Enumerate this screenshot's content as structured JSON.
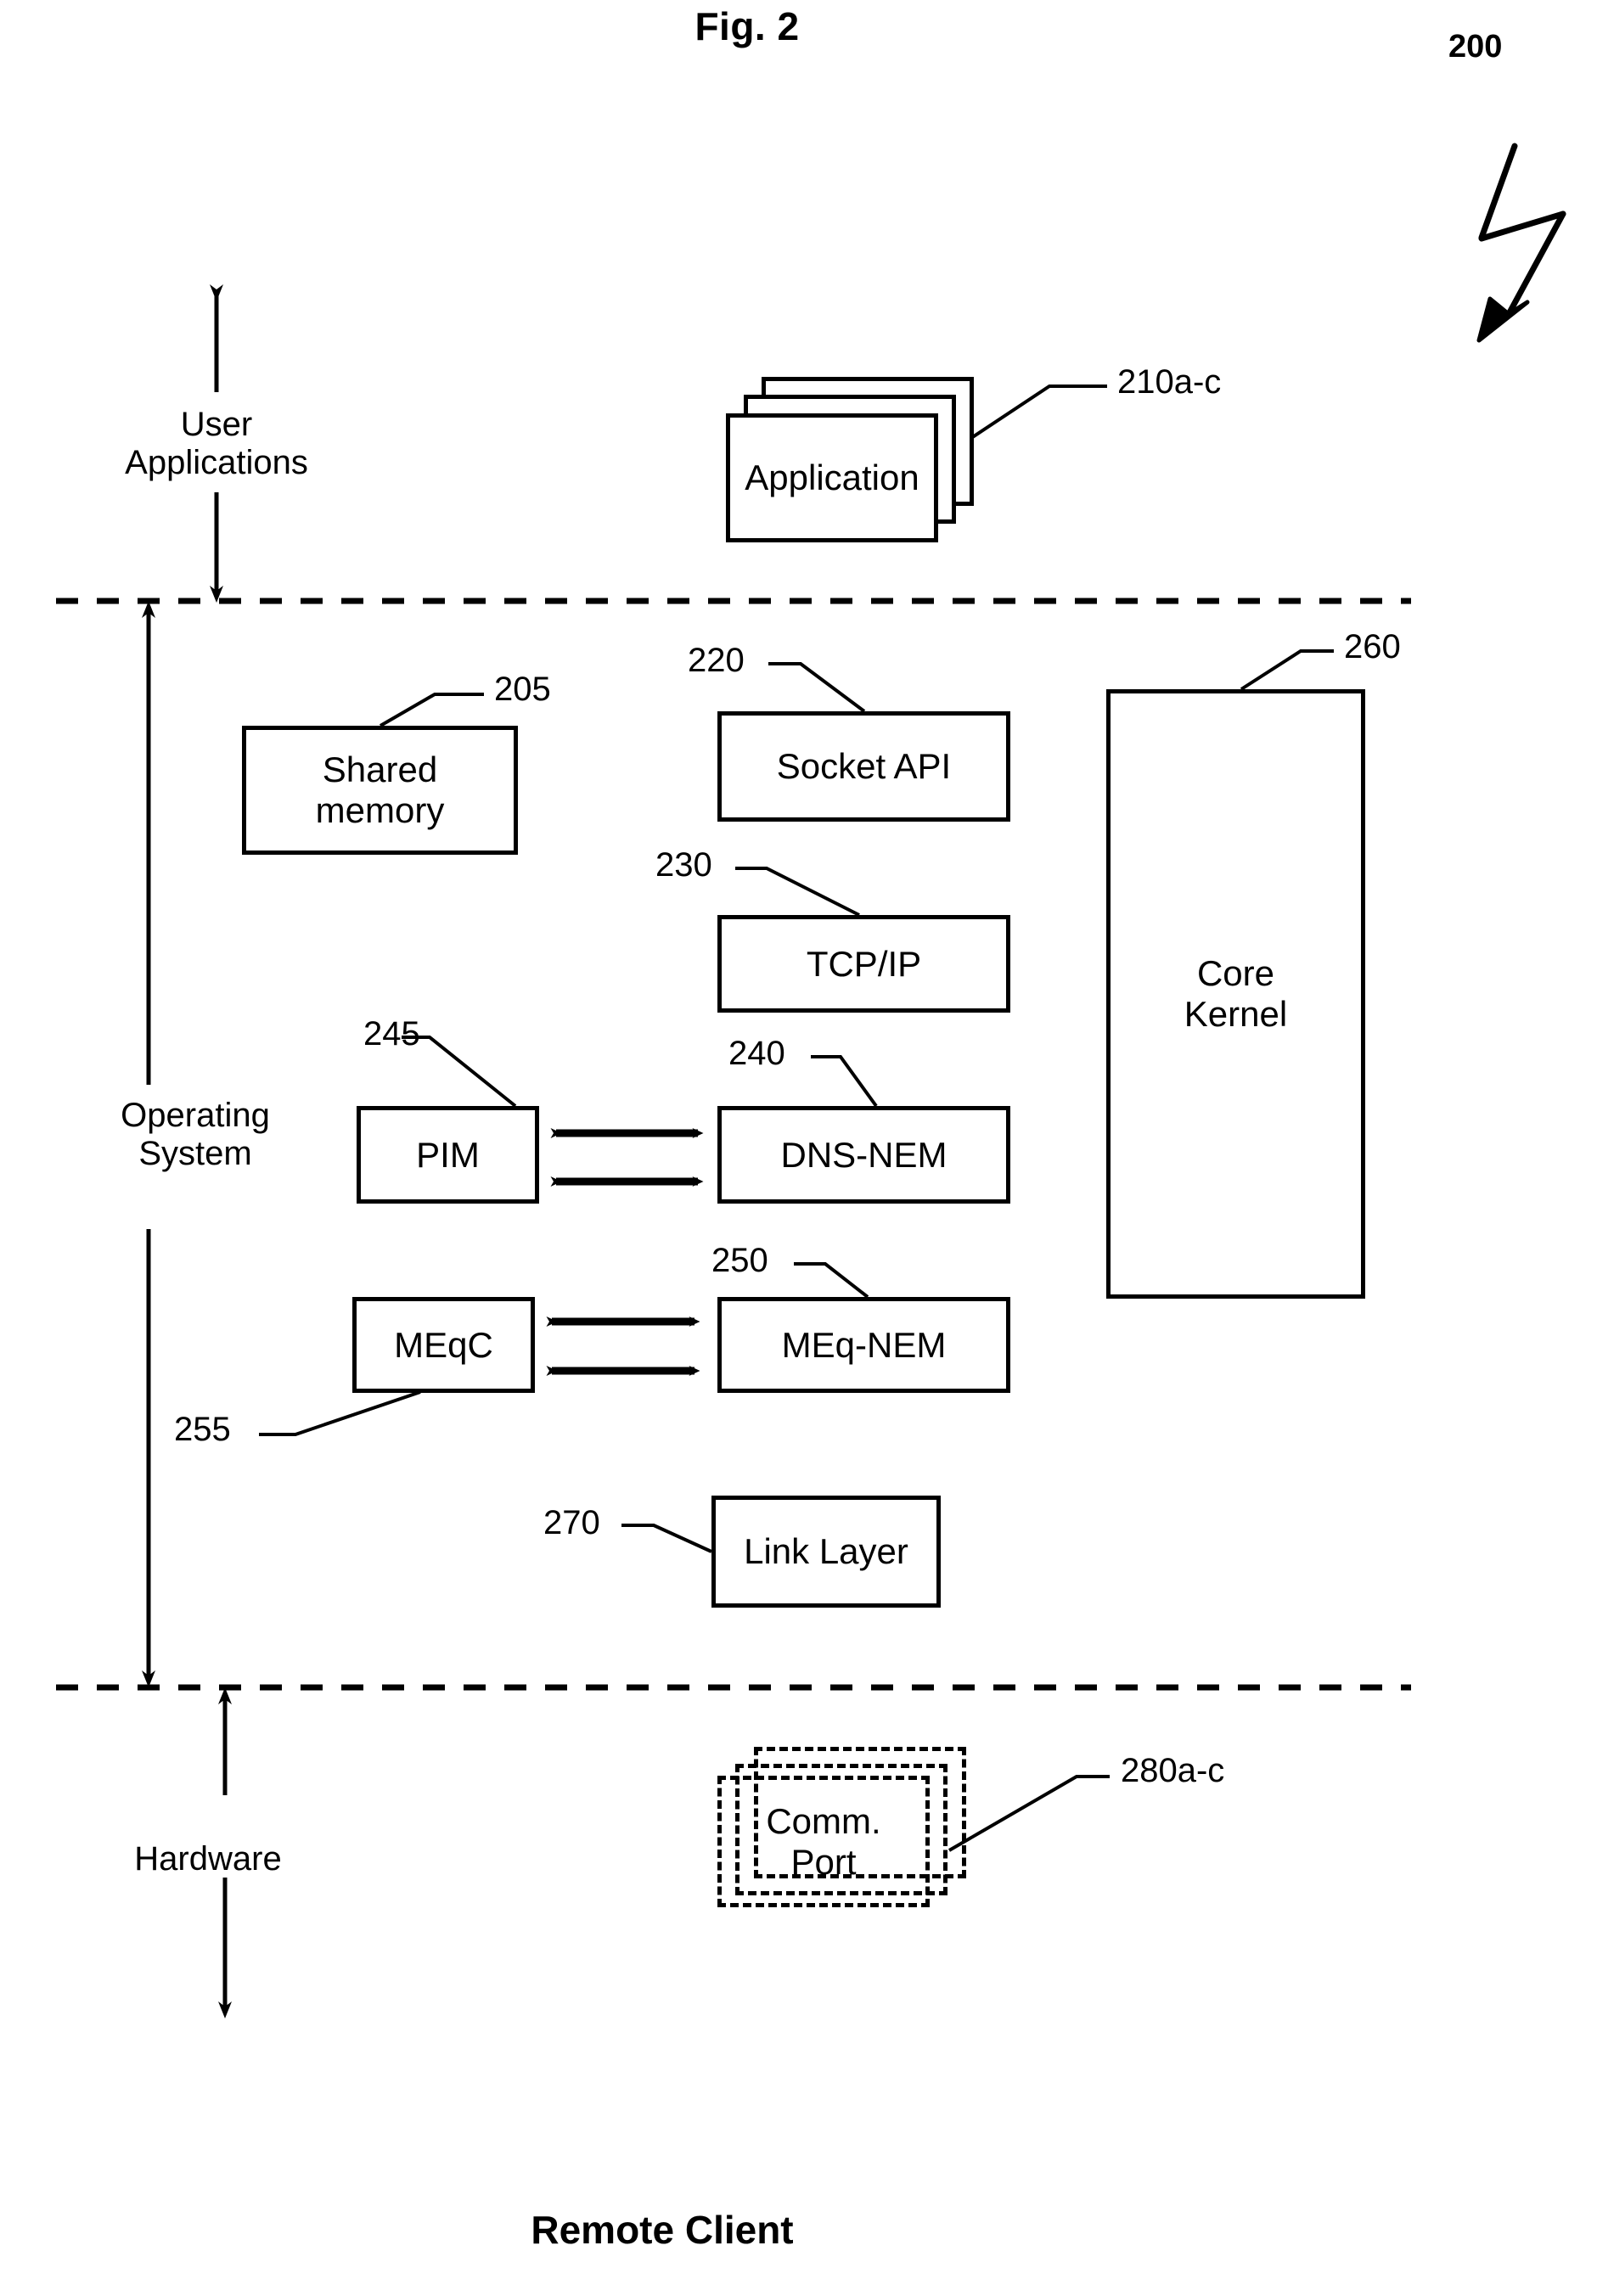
{
  "figure": {
    "title": "Fig. 2",
    "bottom_caption": "Remote Client",
    "diagram_ref": "200"
  },
  "regions": [
    {
      "name": "user-applications",
      "label": "User\nApplications"
    },
    {
      "name": "operating-system",
      "label": "Operating\nSystem"
    },
    {
      "name": "hardware",
      "label": "Hardware"
    }
  ],
  "blocks": [
    {
      "name": "application",
      "label": "Application",
      "ref": "210a-c",
      "stacked": true,
      "style": "solid"
    },
    {
      "name": "shared-memory",
      "label": "Shared\nmemory",
      "ref": "205",
      "stacked": false,
      "style": "solid"
    },
    {
      "name": "socket-api",
      "label": "Socket  API",
      "ref": "220",
      "stacked": false,
      "style": "solid"
    },
    {
      "name": "tcp-ip",
      "label": "TCP/IP",
      "ref": "230",
      "stacked": false,
      "style": "solid"
    },
    {
      "name": "pim",
      "label": "PIM",
      "ref": "245",
      "stacked": false,
      "style": "solid"
    },
    {
      "name": "dns-nem",
      "label": "DNS-NEM",
      "ref": "240",
      "stacked": false,
      "style": "solid"
    },
    {
      "name": "meqc",
      "label": "MEqC",
      "ref": "255",
      "stacked": false,
      "style": "solid"
    },
    {
      "name": "meq-nem",
      "label": "MEq-NEM",
      "ref": "250",
      "stacked": false,
      "style": "solid"
    },
    {
      "name": "link-layer",
      "label": "Link Layer",
      "ref": "270",
      "stacked": false,
      "style": "solid"
    },
    {
      "name": "core-kernel",
      "label": "Core\nKernel",
      "ref": "260",
      "stacked": false,
      "style": "solid"
    },
    {
      "name": "comm-port",
      "label": "Comm.\nPort",
      "ref": "280a-c",
      "stacked": true,
      "style": "dashed"
    }
  ],
  "connections": [
    {
      "from": "pim",
      "to": "dns-nem",
      "kind": "bidirectional",
      "count": 2
    },
    {
      "from": "meqc",
      "to": "meq-nem",
      "kind": "bidirectional",
      "count": 2
    }
  ],
  "colors": {
    "stroke": "#000000",
    "background": "#ffffff"
  }
}
